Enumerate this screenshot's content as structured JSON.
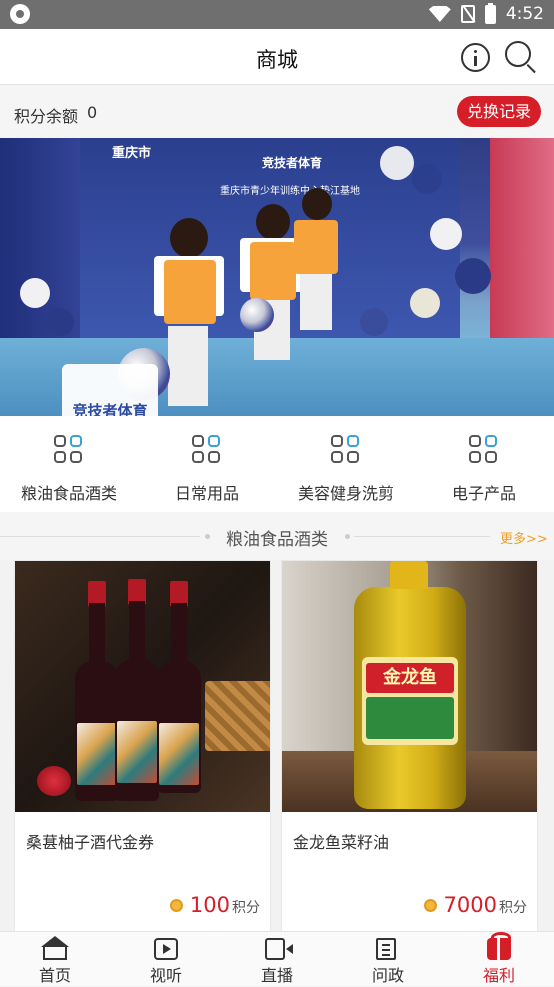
{
  "status_bar": {
    "time": "4:52"
  },
  "header": {
    "title": "商城"
  },
  "points": {
    "label": "积分余额",
    "value": "0",
    "redeem_label": "兑换记录"
  },
  "banner": {
    "sign_text": "重庆市",
    "backdrop_title": "竞技者体育",
    "backdrop_sub": "重庆市青少年训练中心垫江基地",
    "logo_text": "竞技者体育"
  },
  "categories": [
    {
      "label": "粮油食品酒类"
    },
    {
      "label": "日常用品"
    },
    {
      "label": "美容健身洗剪"
    },
    {
      "label": "电子产品"
    }
  ],
  "section": {
    "title": "粮油食品酒类",
    "more": "更多>>"
  },
  "products": [
    {
      "name": "桑葚柚子酒代金券",
      "price": "100",
      "unit": "积分"
    },
    {
      "name": "金龙鱼菜籽油",
      "price": "7000",
      "unit": "积分",
      "brand_label": "金龙鱼"
    }
  ],
  "tabs": [
    {
      "label": "首页"
    },
    {
      "label": "视听"
    },
    {
      "label": "直播"
    },
    {
      "label": "问政"
    },
    {
      "label": "福利"
    }
  ],
  "colors": {
    "accent": "#d51e27",
    "more": "#f0a020"
  }
}
